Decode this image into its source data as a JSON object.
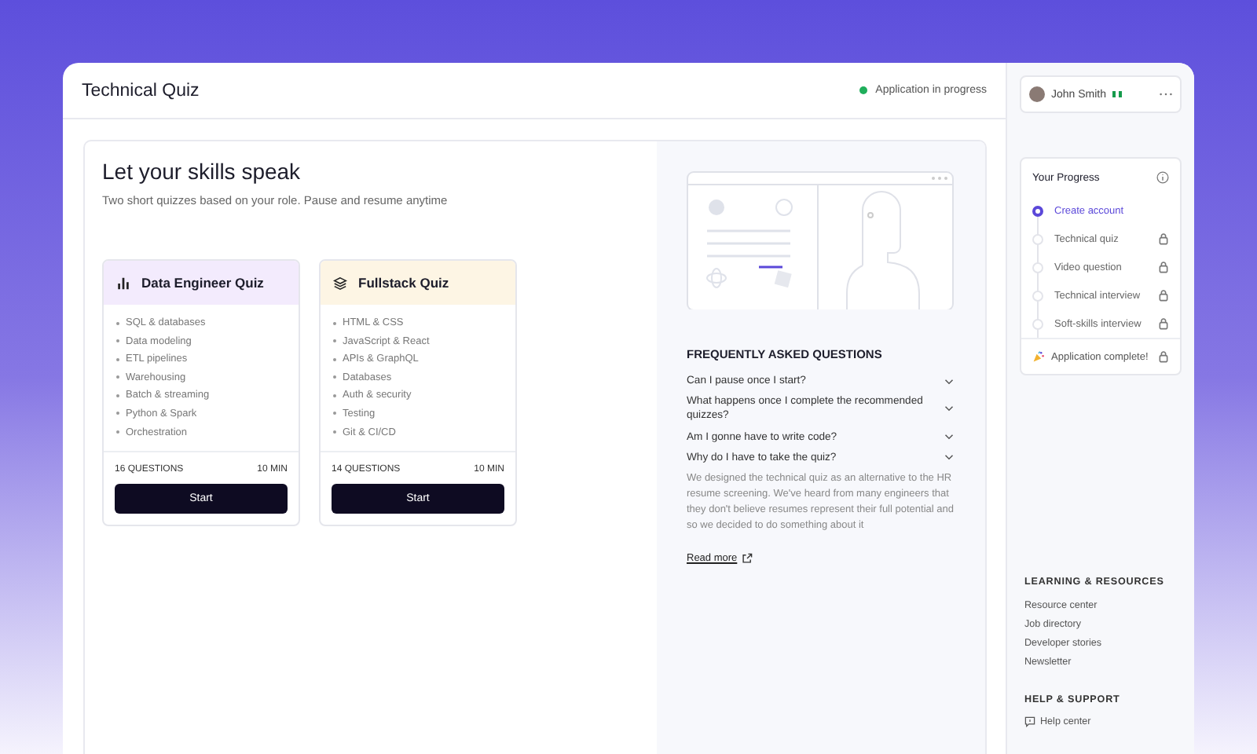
{
  "header": {
    "title": "Technical Quiz",
    "status": "Application in progress"
  },
  "intro": {
    "heading": "Let your skills speak",
    "subtitle": "Two short quizzes based on your role. Pause and resume anytime"
  },
  "quizzes": [
    {
      "kind": "chart",
      "title": "Data Engineer Quiz",
      "color": "#f3ebfd",
      "topics": [
        "SQL & databases",
        "Data modeling",
        "ETL pipelines",
        "Warehousing",
        "Batch & streaming",
        "Python & Spark",
        "Orchestration"
      ],
      "questions": "16 QUESTIONS",
      "duration": "10 MIN",
      "button": "Start"
    },
    {
      "kind": "layers",
      "title": "Fullstack Quiz",
      "color": "#fdf5e4",
      "topics": [
        "HTML & CSS",
        "JavaScript & React",
        "APIs & GraphQL",
        "Databases",
        "Auth & security",
        "Testing",
        "Git & CI/CD"
      ],
      "questions": "14 QUESTIONS",
      "duration": "10 MIN",
      "button": "Start"
    }
  ],
  "faq": {
    "heading": "FREQUENTLY ASKED QUESTIONS",
    "items": [
      {
        "question": "Can I pause once I start?"
      },
      {
        "question": "What happens once I complete the recommended quizzes?"
      },
      {
        "question": "Am I gonne have to write code?"
      },
      {
        "question": "Why do I have to take the quiz?",
        "answer": "We designed the technical quiz as an alternative to the HR resume screening. We've heard from many engineers that they don't believe resumes represent their full potential and so we decided to do something about it"
      }
    ],
    "link": "Read more"
  },
  "user": {
    "name": "John Smith"
  },
  "progress": {
    "title": "Your Progress",
    "steps": [
      {
        "label": "Create account",
        "selected": true,
        "locked": false
      },
      {
        "label": "Technical quiz",
        "selected": false,
        "locked": true
      },
      {
        "label": "Video question",
        "selected": false,
        "locked": true
      },
      {
        "label": "Technical interview",
        "selected": false,
        "locked": true
      },
      {
        "label": "Soft-skills interview",
        "selected": false,
        "locked": true
      }
    ],
    "final": {
      "label": "Application complete!",
      "locked": true
    }
  },
  "sections": [
    {
      "title": "LEARNING & RESOURCES",
      "links": [
        {
          "label": "Resource center"
        },
        {
          "label": "Job directory"
        },
        {
          "label": "Developer stories"
        },
        {
          "label": "Newsletter"
        }
      ]
    },
    {
      "title": "HELP & SUPPORT",
      "links": [
        {
          "label": "Help center",
          "kind": "help"
        }
      ]
    }
  ]
}
